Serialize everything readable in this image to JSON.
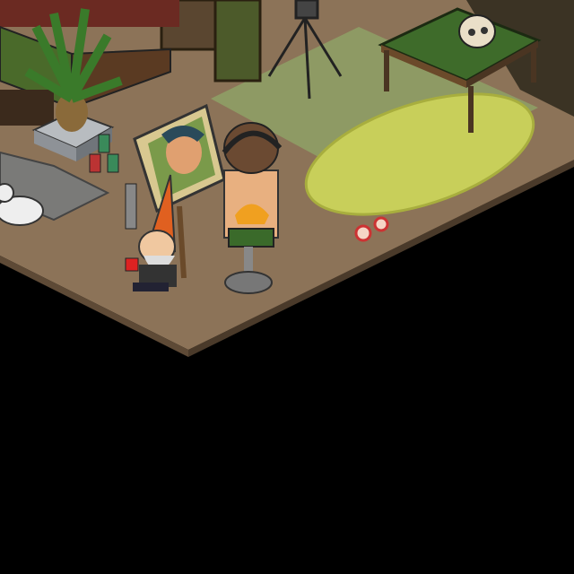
{
  "scene": {
    "type": "isometric-room",
    "colors": {
      "background": "#000000",
      "floor": "#8c7358",
      "floor_edge": "#5e4a36",
      "green_rug": "#8e9a64",
      "yellow_rug": "#c8cf5a",
      "table_top": "#3e6b2a",
      "wood": "#4a3522"
    },
    "objects": [
      "floor-tiles",
      "green-rug",
      "yellow-oval-rug",
      "table",
      "skull",
      "tripod-camera",
      "cabinet",
      "palm-plant",
      "cans",
      "striped-rug",
      "white-dog",
      "gnome-avatar",
      "easel-portrait",
      "avatar-on-stool",
      "bar-stool",
      "sofa",
      "floor-candies"
    ]
  }
}
